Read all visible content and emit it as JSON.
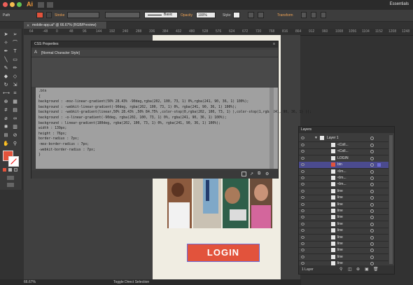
{
  "colors": {
    "accent": "#f59d3c",
    "login_button": "#e2533c",
    "selection": "#6c6bd8",
    "fill_swatch": "#e2533c"
  },
  "menubar": {
    "app_logo": "Ai",
    "workspace": "Essentials"
  },
  "controlbar": {
    "object_type": "Path",
    "stroke_label": "Stroke",
    "brush_label": "Basic",
    "opacity_label": "Opacity",
    "opacity_value": "100%",
    "style_label": "Style:",
    "transform_label": "Transform"
  },
  "document": {
    "tab_title": "mobile-app.ai* @ 66.67% (RGB/Preview)"
  },
  "ruler": {
    "ticks": [
      "64",
      "-48",
      "0",
      "48",
      "96",
      "144",
      "192",
      "240",
      "288",
      "336",
      "384",
      "432",
      "480",
      "528",
      "576",
      "624",
      "672",
      "720",
      "768",
      "816",
      "864",
      "912",
      "960",
      "1008",
      "1056",
      "1104",
      "1152",
      "1208",
      "1248"
    ]
  },
  "css_panel": {
    "title": "CSS Properties",
    "style_name": "[Normal Character Style]",
    "code_lines": [
      ".btn",
      "{",
      "  background : -moz-linear-gradient(50% 28.43% -90deg,rgba(202, 100, 73, 1) 0%,rgba(241, 90, 36, 1) 100%);",
      "  background : -webkit-linear-gradient(-90deg, rgba(202, 100, 73, 1) 0%, rgba(241, 90, 36, 1) 100%);",
      "  background : -webkit-gradient(linear,50% 28.43% ,50% 84.75% ,color-stop(0,rgba(202, 100, 73, 1) ),color-stop(1,rgba(241, 90, 36, 1) ));",
      "  background : -o-linear-gradient(-90deg, rgba(202, 100, 73, 1) 0%, rgba(241, 90, 36, 1) 100%);",
      "  background : linear-gradient(180deg, rgba(202, 100, 73, 1) 0%, rgba(241, 90, 36, 1) 100%);",
      "  width : 139px;",
      "  height : 76px;",
      "  border-radius : 7px;",
      "  -moz-border-radius : 7px;",
      "  -webkit-border-radius : 7px;",
      "}"
    ]
  },
  "artboard": {
    "login_label": "LOGIN"
  },
  "layers_panel": {
    "tab_label": "Layers",
    "layer_name": "Layer 1",
    "rows": [
      "<Coll...",
      "<Coll...",
      "LOGIN",
      "btn",
      "<Im...",
      "<Im...",
      "<Im...",
      "line",
      "line",
      "line",
      "line",
      "line",
      "line",
      "line",
      "line",
      "line",
      "line",
      "line",
      "line"
    ],
    "footer": "1 Layer"
  },
  "status": {
    "zoom": "66.67%",
    "tool": "Toggle Direct Selection"
  }
}
